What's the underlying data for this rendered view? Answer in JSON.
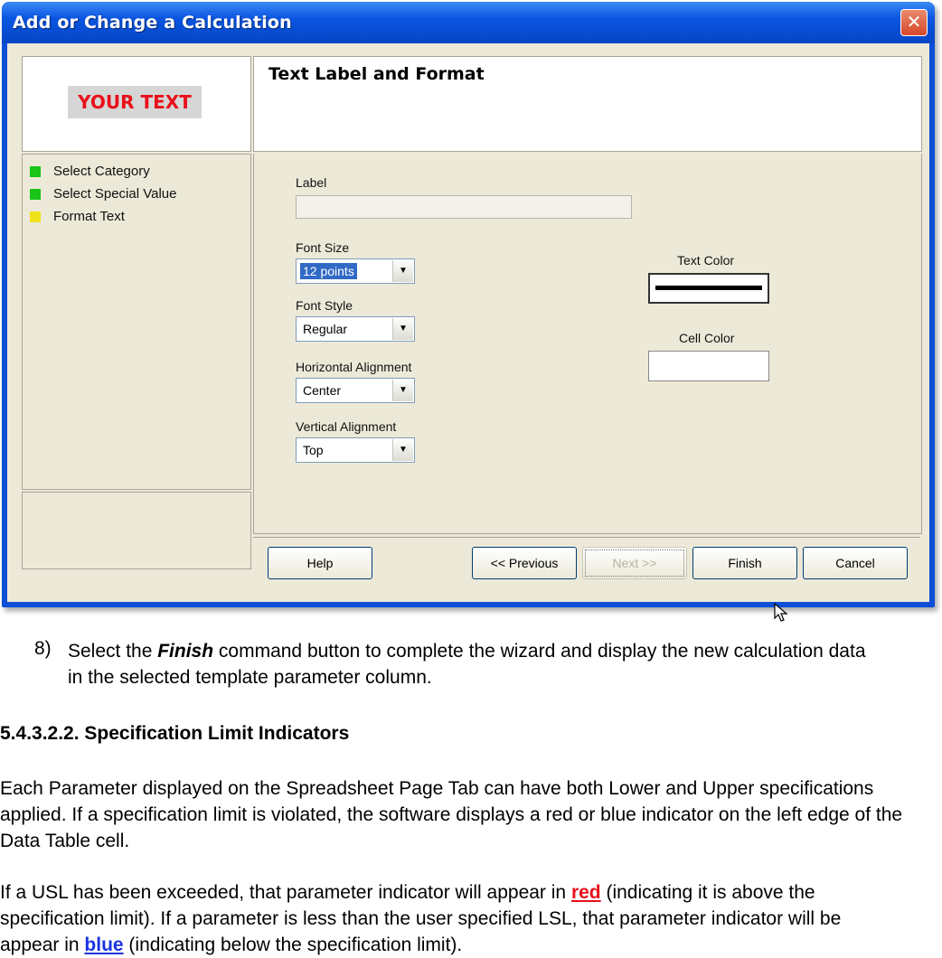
{
  "dialog": {
    "title": "Add or Change a Calculation",
    "close_glyph": "✕",
    "preview_text": "YOUR TEXT",
    "steps": [
      {
        "label": "Select Category",
        "color": "#19c519"
      },
      {
        "label": "Select Special Value",
        "color": "#19c519"
      },
      {
        "label": "Format Text",
        "color": "#f0e21a"
      }
    ],
    "header_title": "Text Label and Format",
    "form": {
      "label_caption": "Label",
      "label_value": "",
      "font_size_caption": "Font Size",
      "font_size_value": "12 points",
      "font_style_caption": "Font Style",
      "font_style_value": "Regular",
      "h_align_caption": "Horizontal Alignment",
      "h_align_value": "Center",
      "v_align_caption": "Vertical Alignment",
      "v_align_value": "Top",
      "text_color_caption": "Text Color",
      "cell_color_caption": "Cell Color",
      "dropdown_glyph": "▼"
    },
    "buttons": {
      "help": "Help",
      "previous": "<< Previous",
      "next": "Next >>",
      "finish": "Finish",
      "cancel": "Cancel"
    }
  },
  "doc": {
    "step_number": "8)",
    "step_pre": "Select the ",
    "step_bold": "Finish",
    "step_post": " command button to complete the wizard and display the new calculation data in the selected template parameter column.",
    "heading": "5.4.3.2.2. Specification Limit Indicators",
    "para1": "Each Parameter displayed on the Spreadsheet Page Tab can have both Lower and Upper specifications applied. If a specification limit is violated, the software displays a red or blue indicator on the left edge of the Data Table cell.",
    "para2_a": "If a USL has been exceeded, that parameter indicator will appear in ",
    "para2_red": "red",
    "para2_b": " (indicating it is above the specification limit). If a parameter is less than the user specified LSL, that parameter indicator will be appear in ",
    "para2_blue": "blue",
    "para2_c": " (indicating below the specification limit)."
  }
}
